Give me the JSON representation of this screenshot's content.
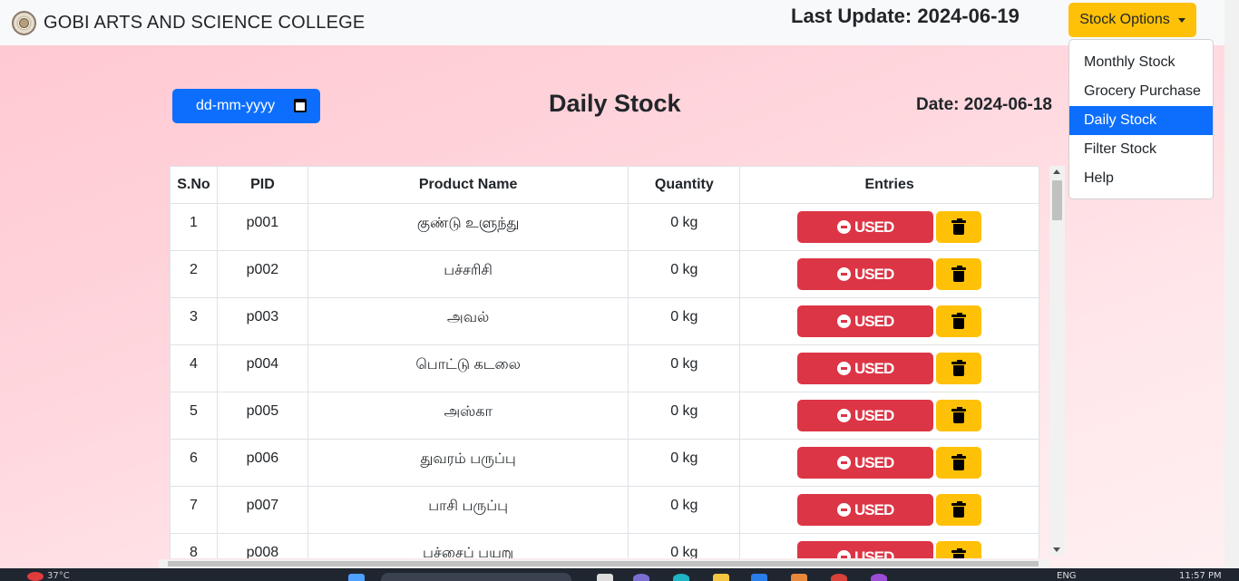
{
  "navbar": {
    "college_name": "GOBI ARTS AND SCIENCE COLLEGE",
    "last_update": "Last Update: 2024-06-19",
    "stock_options_label": "Stock Options"
  },
  "dropdown": {
    "items": [
      "Monthly Stock",
      "Grocery Purchase",
      "Daily Stock",
      "Filter Stock",
      "Help"
    ],
    "active": "Daily Stock"
  },
  "main": {
    "date_placeholder": "dd-mm-yyyy",
    "title": "Daily Stock",
    "date_label": "Date: 2024-06-18"
  },
  "table": {
    "headers": [
      "S.No",
      "PID",
      "Product Name",
      "Quantity",
      "Entries"
    ],
    "used_label": "USED",
    "rows": [
      {
        "sno": "1",
        "pid": "p001",
        "name": "குண்டு உளுந்து",
        "qty": "0 kg"
      },
      {
        "sno": "2",
        "pid": "p002",
        "name": "பச்சரிசி",
        "qty": "0 kg"
      },
      {
        "sno": "3",
        "pid": "p003",
        "name": "அவல்",
        "qty": "0 kg"
      },
      {
        "sno": "4",
        "pid": "p004",
        "name": "பொட்டு கடலை",
        "qty": "0 kg"
      },
      {
        "sno": "5",
        "pid": "p005",
        "name": "அஸ்கா",
        "qty": "0 kg"
      },
      {
        "sno": "6",
        "pid": "p006",
        "name": "துவரம் பருப்பு",
        "qty": "0 kg"
      },
      {
        "sno": "7",
        "pid": "p007",
        "name": "பாசி பருப்பு",
        "qty": "0 kg"
      },
      {
        "sno": "8",
        "pid": "p008",
        "name": "பச்சைப் பயறு",
        "qty": "0 kg"
      }
    ]
  },
  "taskbar": {
    "temperature": "37°C",
    "language": "ENG",
    "time": "11:57 PM"
  },
  "colors": {
    "primary": "#0d6efd",
    "danger": "#dc3545",
    "warning": "#ffc107"
  }
}
